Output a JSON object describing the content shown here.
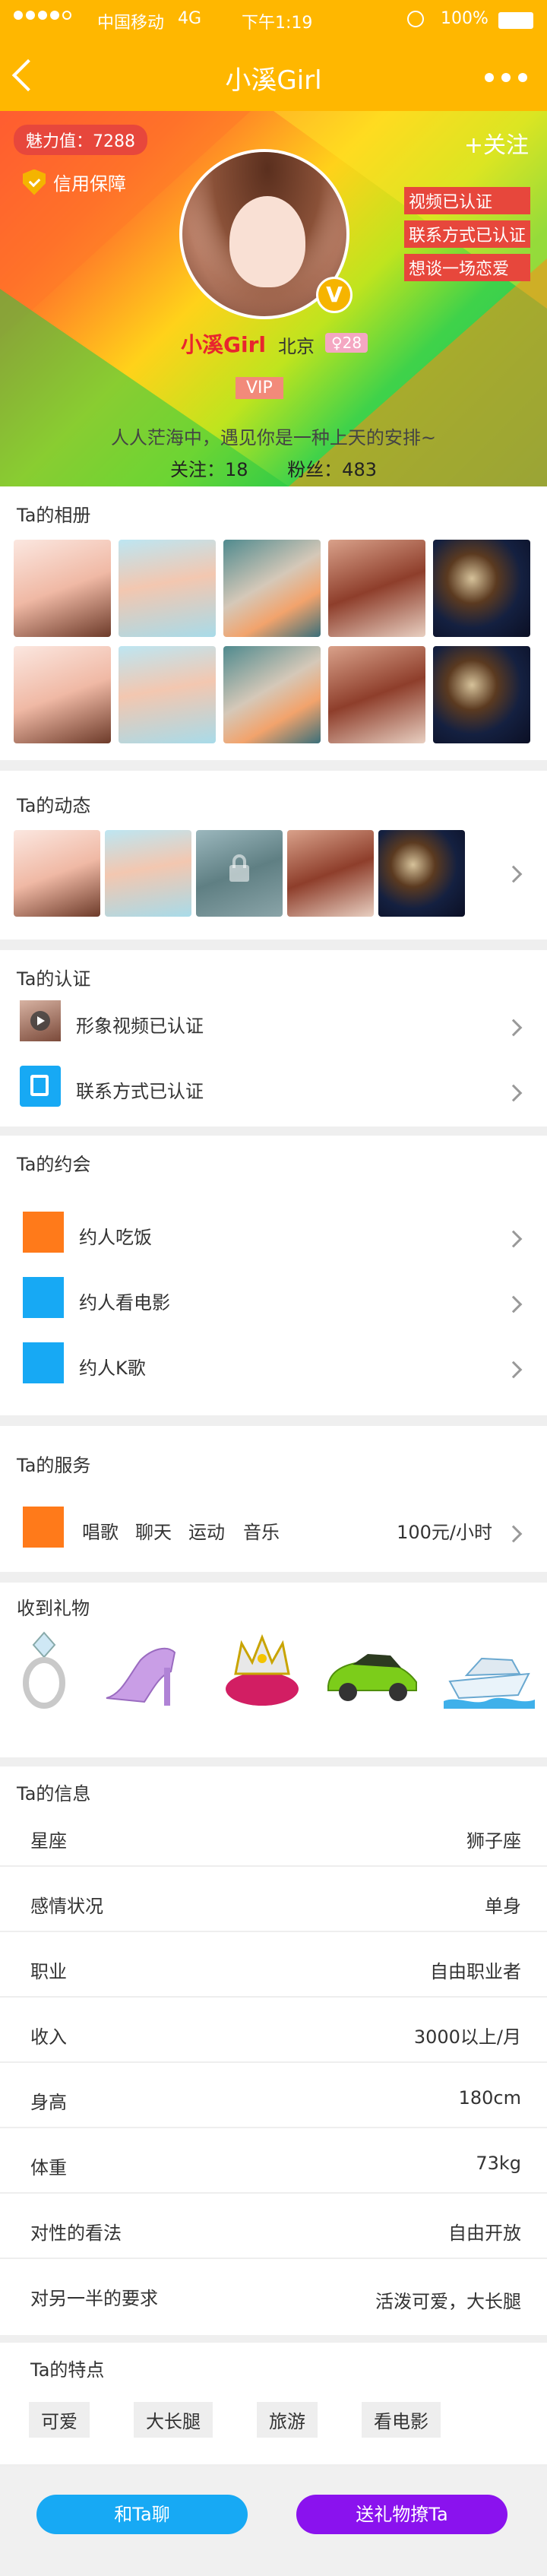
{
  "status": {
    "carrier": "中国移动",
    "network": "4G",
    "time": "下午1:19",
    "battery": "100%"
  },
  "nav": {
    "title": "小溪Girl"
  },
  "hero": {
    "charm": "魅力值：7288",
    "guarantee": "信用保障",
    "follow_label": "+关注",
    "tags": [
      "视频已认证",
      "联系方式已认证",
      "想谈一场恋爱"
    ],
    "badge": "V",
    "name": "小溪Girl",
    "city": "北京",
    "age": "♀28",
    "vip": "VIP",
    "motto": "人人茫海中，遇见你是一种上天的安排~",
    "following": "关注：18",
    "fans": "粉丝：483"
  },
  "album": {
    "title": "Ta的相册"
  },
  "moments": {
    "title": "Ta的动态"
  },
  "verify": {
    "title": "Ta的认证",
    "items": [
      "形象视频已认证",
      "联系方式已认证"
    ]
  },
  "dates": {
    "title": "Ta的约会",
    "items": [
      "约人吃饭",
      "约人看电影",
      "约人K歌"
    ]
  },
  "service": {
    "title": "Ta的服务",
    "items": [
      "唱歌",
      "聊天",
      "运动",
      "音乐"
    ],
    "price": "100元/小时"
  },
  "gifts": {
    "title": "收到礼物",
    "icons": [
      "ring-icon",
      "high-heel-icon",
      "crown-icon",
      "car-icon",
      "yacht-icon"
    ]
  },
  "info": {
    "title": "Ta的信息",
    "rows": [
      {
        "label": "星座",
        "value": "狮子座"
      },
      {
        "label": "感情状况",
        "value": "单身"
      },
      {
        "label": "职业",
        "value": "自由职业者"
      },
      {
        "label": "收入",
        "value": "3000以上/月"
      },
      {
        "label": "身高",
        "value": "180cm"
      },
      {
        "label": "体重",
        "value": "73kg"
      },
      {
        "label": "对性的看法",
        "value": "自由开放"
      },
      {
        "label": "对另一半的要求",
        "value": "活泼可爱，大长腿"
      }
    ]
  },
  "traits": {
    "title": "Ta的特点",
    "items": [
      "可爱",
      "大长腿",
      "旅游",
      "看电影"
    ]
  },
  "actions": {
    "chat": "和Ta聊",
    "gift": "送礼物撩Ta"
  },
  "colors": {
    "brand": "#ffb700",
    "orange": "#ff7a1a",
    "blue": "#17a9f4",
    "purple": "#8a12ee",
    "red": "#e7473c"
  }
}
